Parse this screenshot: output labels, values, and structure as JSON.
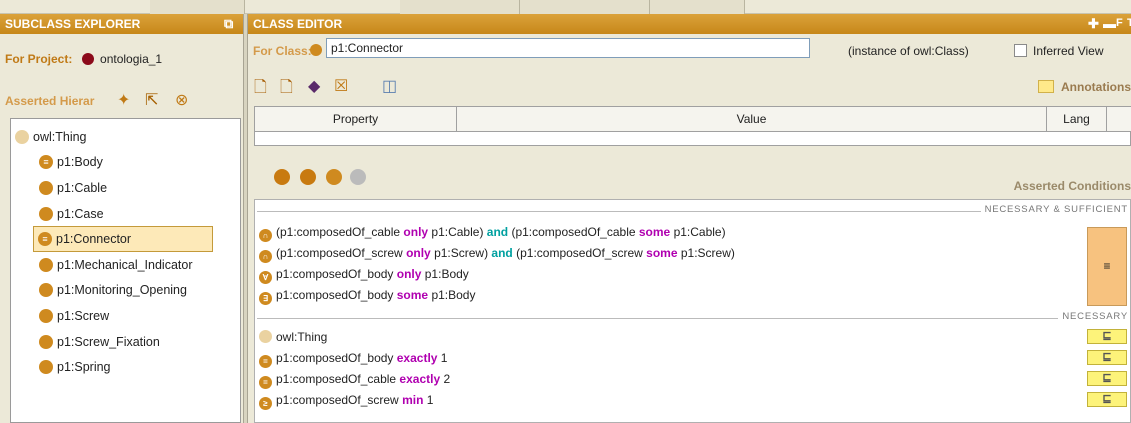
{
  "subclass_explorer": {
    "title": "SUBCLASS EXPLORER",
    "project_label": "For Project:",
    "project_name": "ontologia_1",
    "hierarchy_label": "Asserted Hierar",
    "tree": [
      {
        "label": "owl:Thing",
        "level": 0
      },
      {
        "label": "p1:Body",
        "level": 1
      },
      {
        "label": "p1:Cable",
        "level": 1
      },
      {
        "label": "p1:Case",
        "level": 1
      },
      {
        "label": "p1:Connector",
        "level": 1,
        "selected": true
      },
      {
        "label": "p1:Mechanical_Indicator",
        "level": 1
      },
      {
        "label": "p1:Monitoring_Opening",
        "level": 1
      },
      {
        "label": "p1:Screw",
        "level": 1
      },
      {
        "label": "p1:Screw_Fixation",
        "level": 1
      },
      {
        "label": "p1:Spring",
        "level": 1
      }
    ]
  },
  "class_editor": {
    "title": "CLASS EDITOR",
    "for_class_label": "For Class:",
    "class_name": "p1:Connector",
    "instance_of": "(instance of owl:Class)",
    "inferred_view_label": "Inferred View",
    "annotations_label": "Annotations",
    "property_table": {
      "headers": [
        "Property",
        "Value",
        "Lang"
      ]
    },
    "asserted_conditions_label": "Asserted Conditions",
    "necessary_sufficient_label": "NECESSARY & SUFFICIENT",
    "necessary_label": "NECESSARY",
    "equivalent_symbol": "≡",
    "subclass_symbol": "⊑",
    "necessary_sufficient": [
      [
        {
          "t": "(p1:composedOf_cable "
        },
        {
          "k": "only"
        },
        {
          "t": " p1:Cable) "
        },
        {
          "a": "and"
        },
        {
          "t": " (p1:composedOf_cable "
        },
        {
          "k": "some"
        },
        {
          "t": " p1:Cable)"
        }
      ],
      [
        {
          "t": "(p1:composedOf_screw "
        },
        {
          "k": "only"
        },
        {
          "t": " p1:Screw) "
        },
        {
          "a": "and"
        },
        {
          "t": " (p1:composedOf_screw "
        },
        {
          "k": "some"
        },
        {
          "t": " p1:Screw)"
        }
      ],
      [
        {
          "t": "p1:composedOf_body "
        },
        {
          "k": "only"
        },
        {
          "t": " p1:Body"
        }
      ],
      [
        {
          "t": "p1:composedOf_body "
        },
        {
          "k": "some"
        },
        {
          "t": " p1:Body"
        }
      ]
    ],
    "necessary": [
      [
        {
          "t": "owl:Thing"
        }
      ],
      [
        {
          "t": "p1:composedOf_body "
        },
        {
          "k": "exactly"
        },
        {
          "t": " 1"
        }
      ],
      [
        {
          "t": "p1:composedOf_cable "
        },
        {
          "k": "exactly"
        },
        {
          "t": " 2"
        }
      ],
      [
        {
          "t": "p1:composedOf_screw "
        },
        {
          "k": "min"
        },
        {
          "t": " 1"
        }
      ]
    ]
  },
  "colors": {
    "header": "#c78719",
    "class_dot": "#cf8a1f",
    "project_dot": "#8b0a1a",
    "keyword_purple": "#b000b0",
    "keyword_teal": "#00a0a0"
  }
}
